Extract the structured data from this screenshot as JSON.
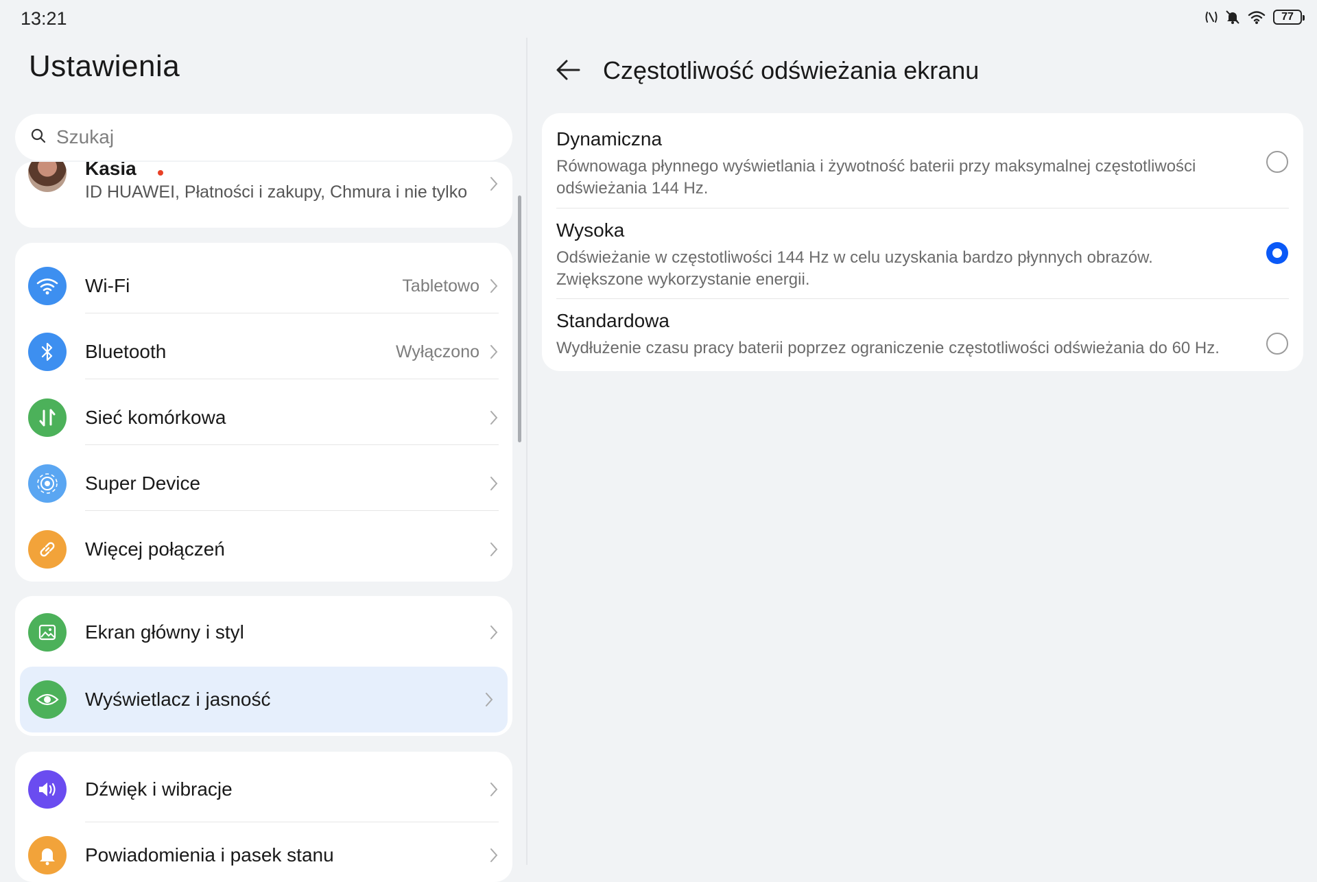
{
  "status_bar": {
    "time": "13:21",
    "battery": "77",
    "icons": [
      "nfc-icon",
      "bell-muted-icon",
      "wifi-icon",
      "battery-icon"
    ]
  },
  "left": {
    "title": "Ustawienia",
    "search_placeholder": "Szukaj",
    "account": {
      "name": "Kasia",
      "subtitle": "ID HUAWEI, Płatności i zakupy, Chmura i nie tylko"
    },
    "groups": [
      {
        "items": [
          {
            "label": "Wi-Fi",
            "value": "Tabletowo",
            "icon": "wifi-icon",
            "color": "#3d8ff0"
          },
          {
            "label": "Bluetooth",
            "value": "Wyłączono",
            "icon": "bluetooth-icon",
            "color": "#3d8ff0"
          },
          {
            "label": "Sieć komórkowa",
            "value": "",
            "icon": "mobile-data-icon",
            "color": "#4cb15a"
          },
          {
            "label": "Super Device",
            "value": "",
            "icon": "super-device-icon",
            "color": "#3d8ff0"
          },
          {
            "label": "Więcej połączeń",
            "value": "",
            "icon": "link-icon",
            "color": "#f2a33a"
          }
        ]
      },
      {
        "items": [
          {
            "label": "Ekran główny i styl",
            "value": "",
            "icon": "image-icon",
            "color": "#4cb15a"
          },
          {
            "label": "Wyświetlacz i jasność",
            "value": "",
            "icon": "eye-icon",
            "color": "#4cb15a",
            "selected": true
          }
        ]
      },
      {
        "items": [
          {
            "label": "Dźwięk i wibracje",
            "value": "",
            "icon": "speaker-icon",
            "color": "#6a4cf0"
          },
          {
            "label": "Powiadomienia i pasek stanu",
            "value": "",
            "icon": "bell-icon",
            "color": "#f2a33a"
          }
        ]
      }
    ]
  },
  "right": {
    "title": "Częstotliwość odświeżania ekranu",
    "options": [
      {
        "title": "Dynamiczna",
        "desc": "Równowaga płynnego wyświetlania i żywotność baterii przy maksymalnej częstotliwości odświeżania 144 Hz.",
        "selected": false
      },
      {
        "title": "Wysoka",
        "desc": "Odświeżanie w częstotliwości 144 Hz w celu uzyskania bardzo płynnych obrazów. Zwiększone wykorzystanie energii.",
        "selected": true
      },
      {
        "title": "Standardowa",
        "desc": "Wydłużenie czasu pracy baterii poprzez ograniczenie częstotliwości odświeżania do 60 Hz.",
        "selected": false
      }
    ],
    "accent": "#0a59f7"
  }
}
